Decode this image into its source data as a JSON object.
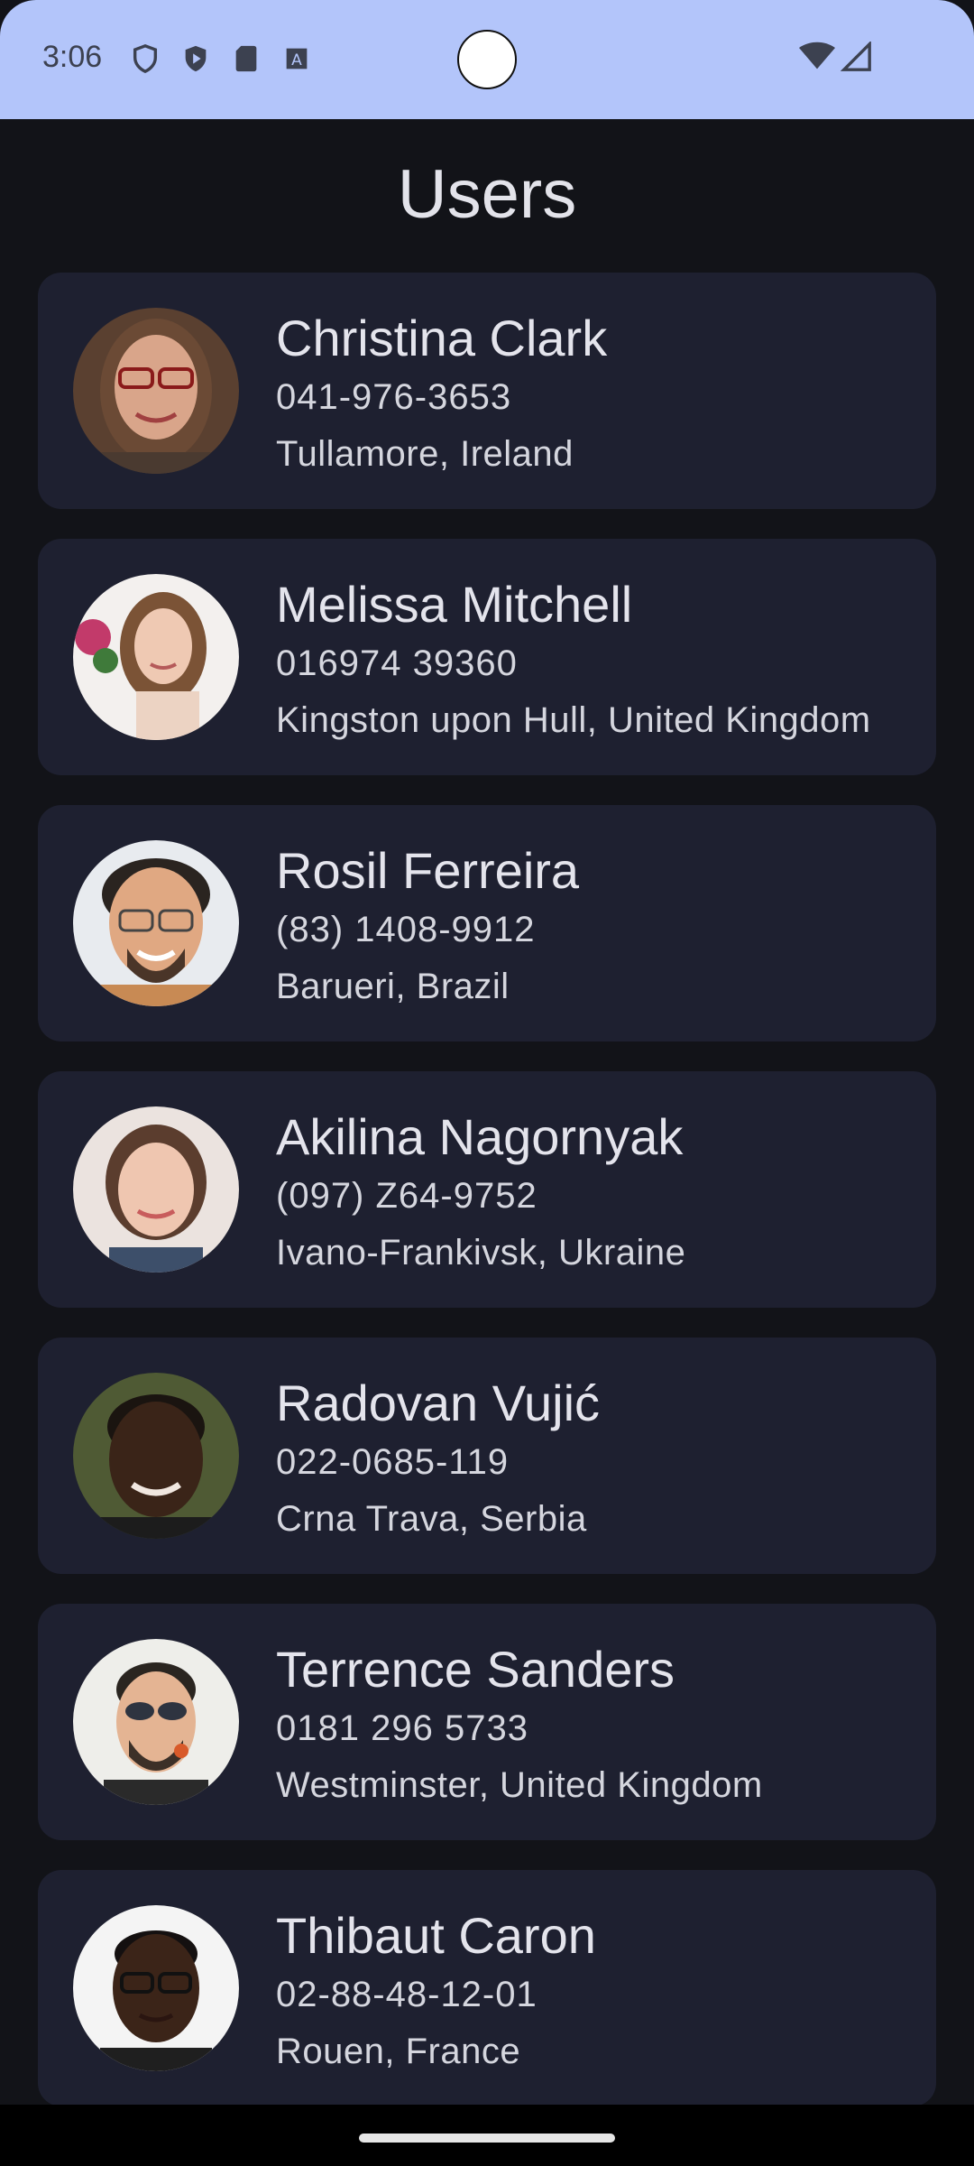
{
  "status_bar": {
    "time": "3:06",
    "bg_color": "#b3c5fa",
    "left_icons": [
      "vpn-shield-icon",
      "play-shield-icon",
      "sd-card-icon",
      "text-a-icon"
    ],
    "right_icons": [
      "wifi-icon",
      "cell-signal-icon"
    ]
  },
  "header": {
    "title": "Users"
  },
  "users": [
    {
      "name": "Christina Clark",
      "phone": "041-976-3653",
      "location": "Tullamore, Ireland"
    },
    {
      "name": "Melissa Mitchell",
      "phone": "016974 39360",
      "location": "Kingston upon Hull, United Kingdom"
    },
    {
      "name": "Rosil Ferreira",
      "phone": "(83) 1408-9912",
      "location": "Barueri, Brazil"
    },
    {
      "name": "Akilina Nagornyak",
      "phone": "(097) Z64-9752",
      "location": "Ivano-Frankivsk, Ukraine"
    },
    {
      "name": "Radovan Vujić",
      "phone": "022-0685-119",
      "location": "Crna Trava, Serbia"
    },
    {
      "name": "Terrence Sanders",
      "phone": "0181 296 5733",
      "location": "Westminster, United Kingdom"
    },
    {
      "name": "Thibaut Caron",
      "phone": "02-88-48-12-01",
      "location": "Rouen, France"
    }
  ],
  "colors": {
    "background": "#121318",
    "card": "#1e2030",
    "text_primary": "#e4e4ec"
  }
}
